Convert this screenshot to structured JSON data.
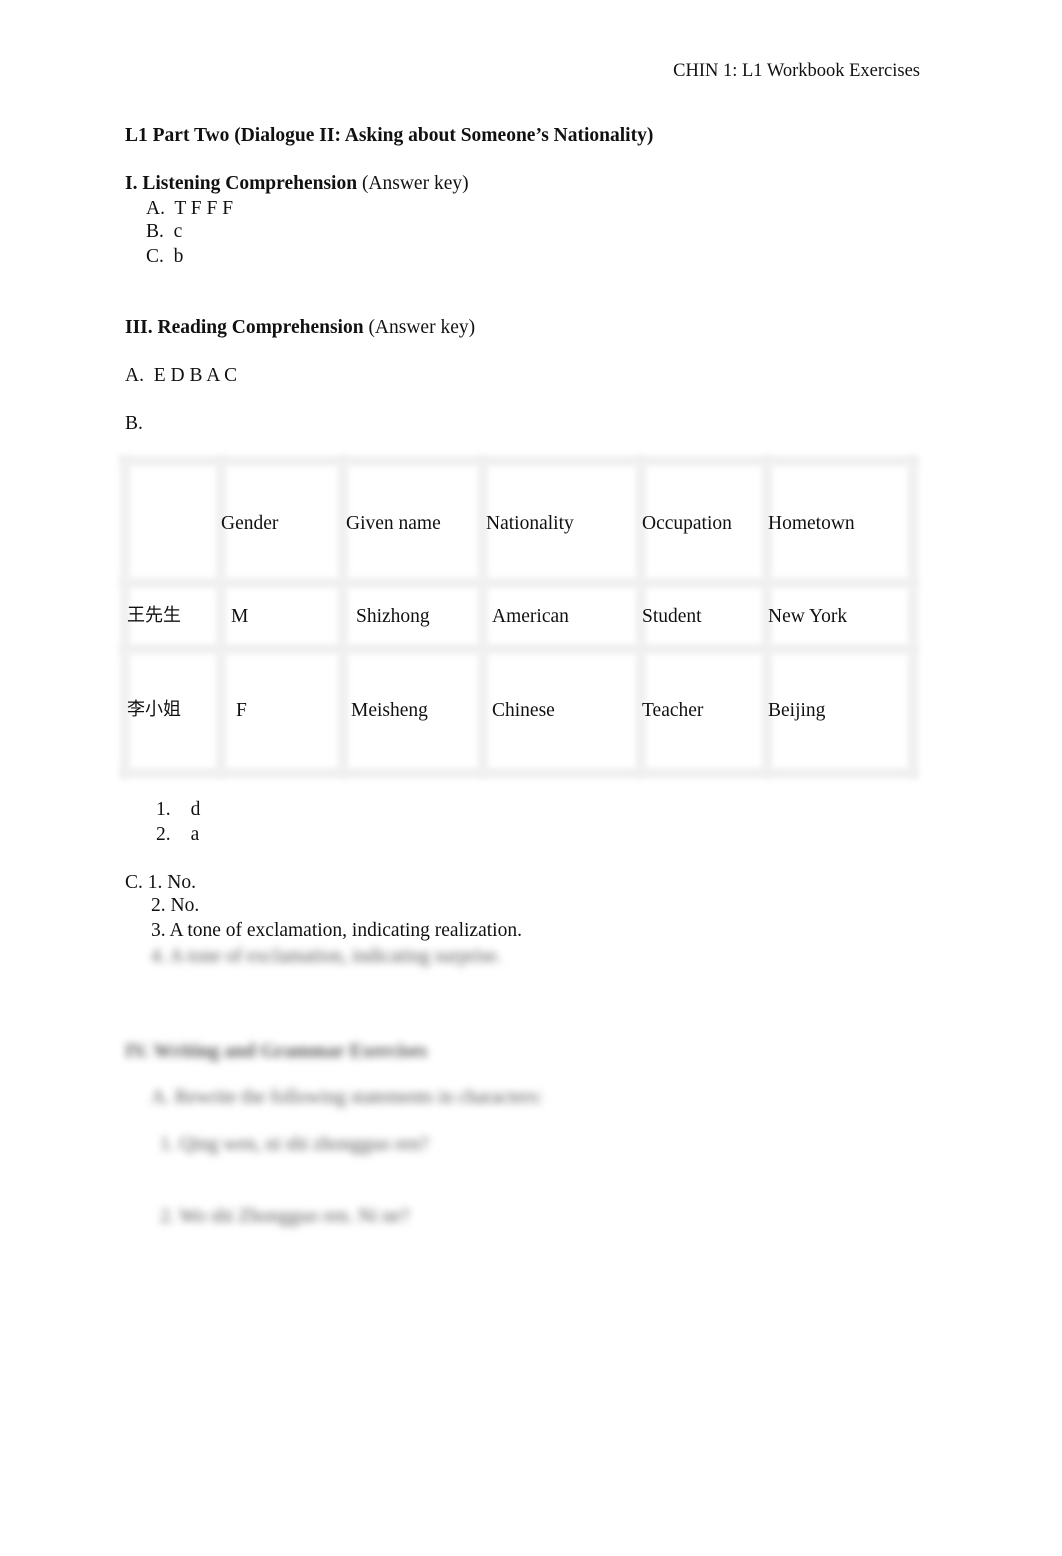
{
  "header": {
    "course_title": "CHIN 1: L1 Workbook Exercises"
  },
  "title": "L1 Part Two (Dialogue II: Asking about Someone’s Nationality)",
  "listening": {
    "heading_bold": "I. Listening Comprehension",
    "heading_normal": " (Answer key)",
    "items": [
      {
        "label": "A.",
        "answer": "T F F F"
      },
      {
        "label": "B.",
        "answer": "c"
      },
      {
        "label": "C.",
        "answer": "b"
      }
    ]
  },
  "reading": {
    "heading_bold": "III. Reading Comprehension",
    "heading_normal": " (Answer key)",
    "part_a": {
      "label": "A.",
      "answer": "E D B A C"
    },
    "part_b": {
      "label": "B.",
      "table": {
        "headers": [
          "",
          "Gender",
          "Given name",
          "Nationality",
          "Occupation",
          "Hometown"
        ],
        "rows": [
          [
            "王先生",
            "M",
            "Shizhong",
            "American",
            "Student",
            "New York"
          ],
          [
            "李小姐",
            "F",
            "Meisheng",
            "Chinese",
            "Teacher",
            "Beijing"
          ]
        ]
      },
      "followups": [
        {
          "label": "1.",
          "answer": "d"
        },
        {
          "label": "2.",
          "answer": "a"
        }
      ]
    },
    "part_c": {
      "label": "C.",
      "items": [
        {
          "label": "1.",
          "answer": "No."
        },
        {
          "label": "2.",
          "answer": "No."
        },
        {
          "label": "3.",
          "answer": "A tone of exclamation, indicating realization."
        }
      ],
      "blurred_item": "4. A tone of exclamation, indicating surprise."
    }
  },
  "blurred_section": {
    "heading": "IV. Writing and Grammar Exercises",
    "instruction": "A. Rewrite the following statements in characters:",
    "items": [
      "1. Qing wen, ni shi zhongguo ren?",
      "2. Wo shi Zhongguo ren. Ni ne?"
    ]
  }
}
